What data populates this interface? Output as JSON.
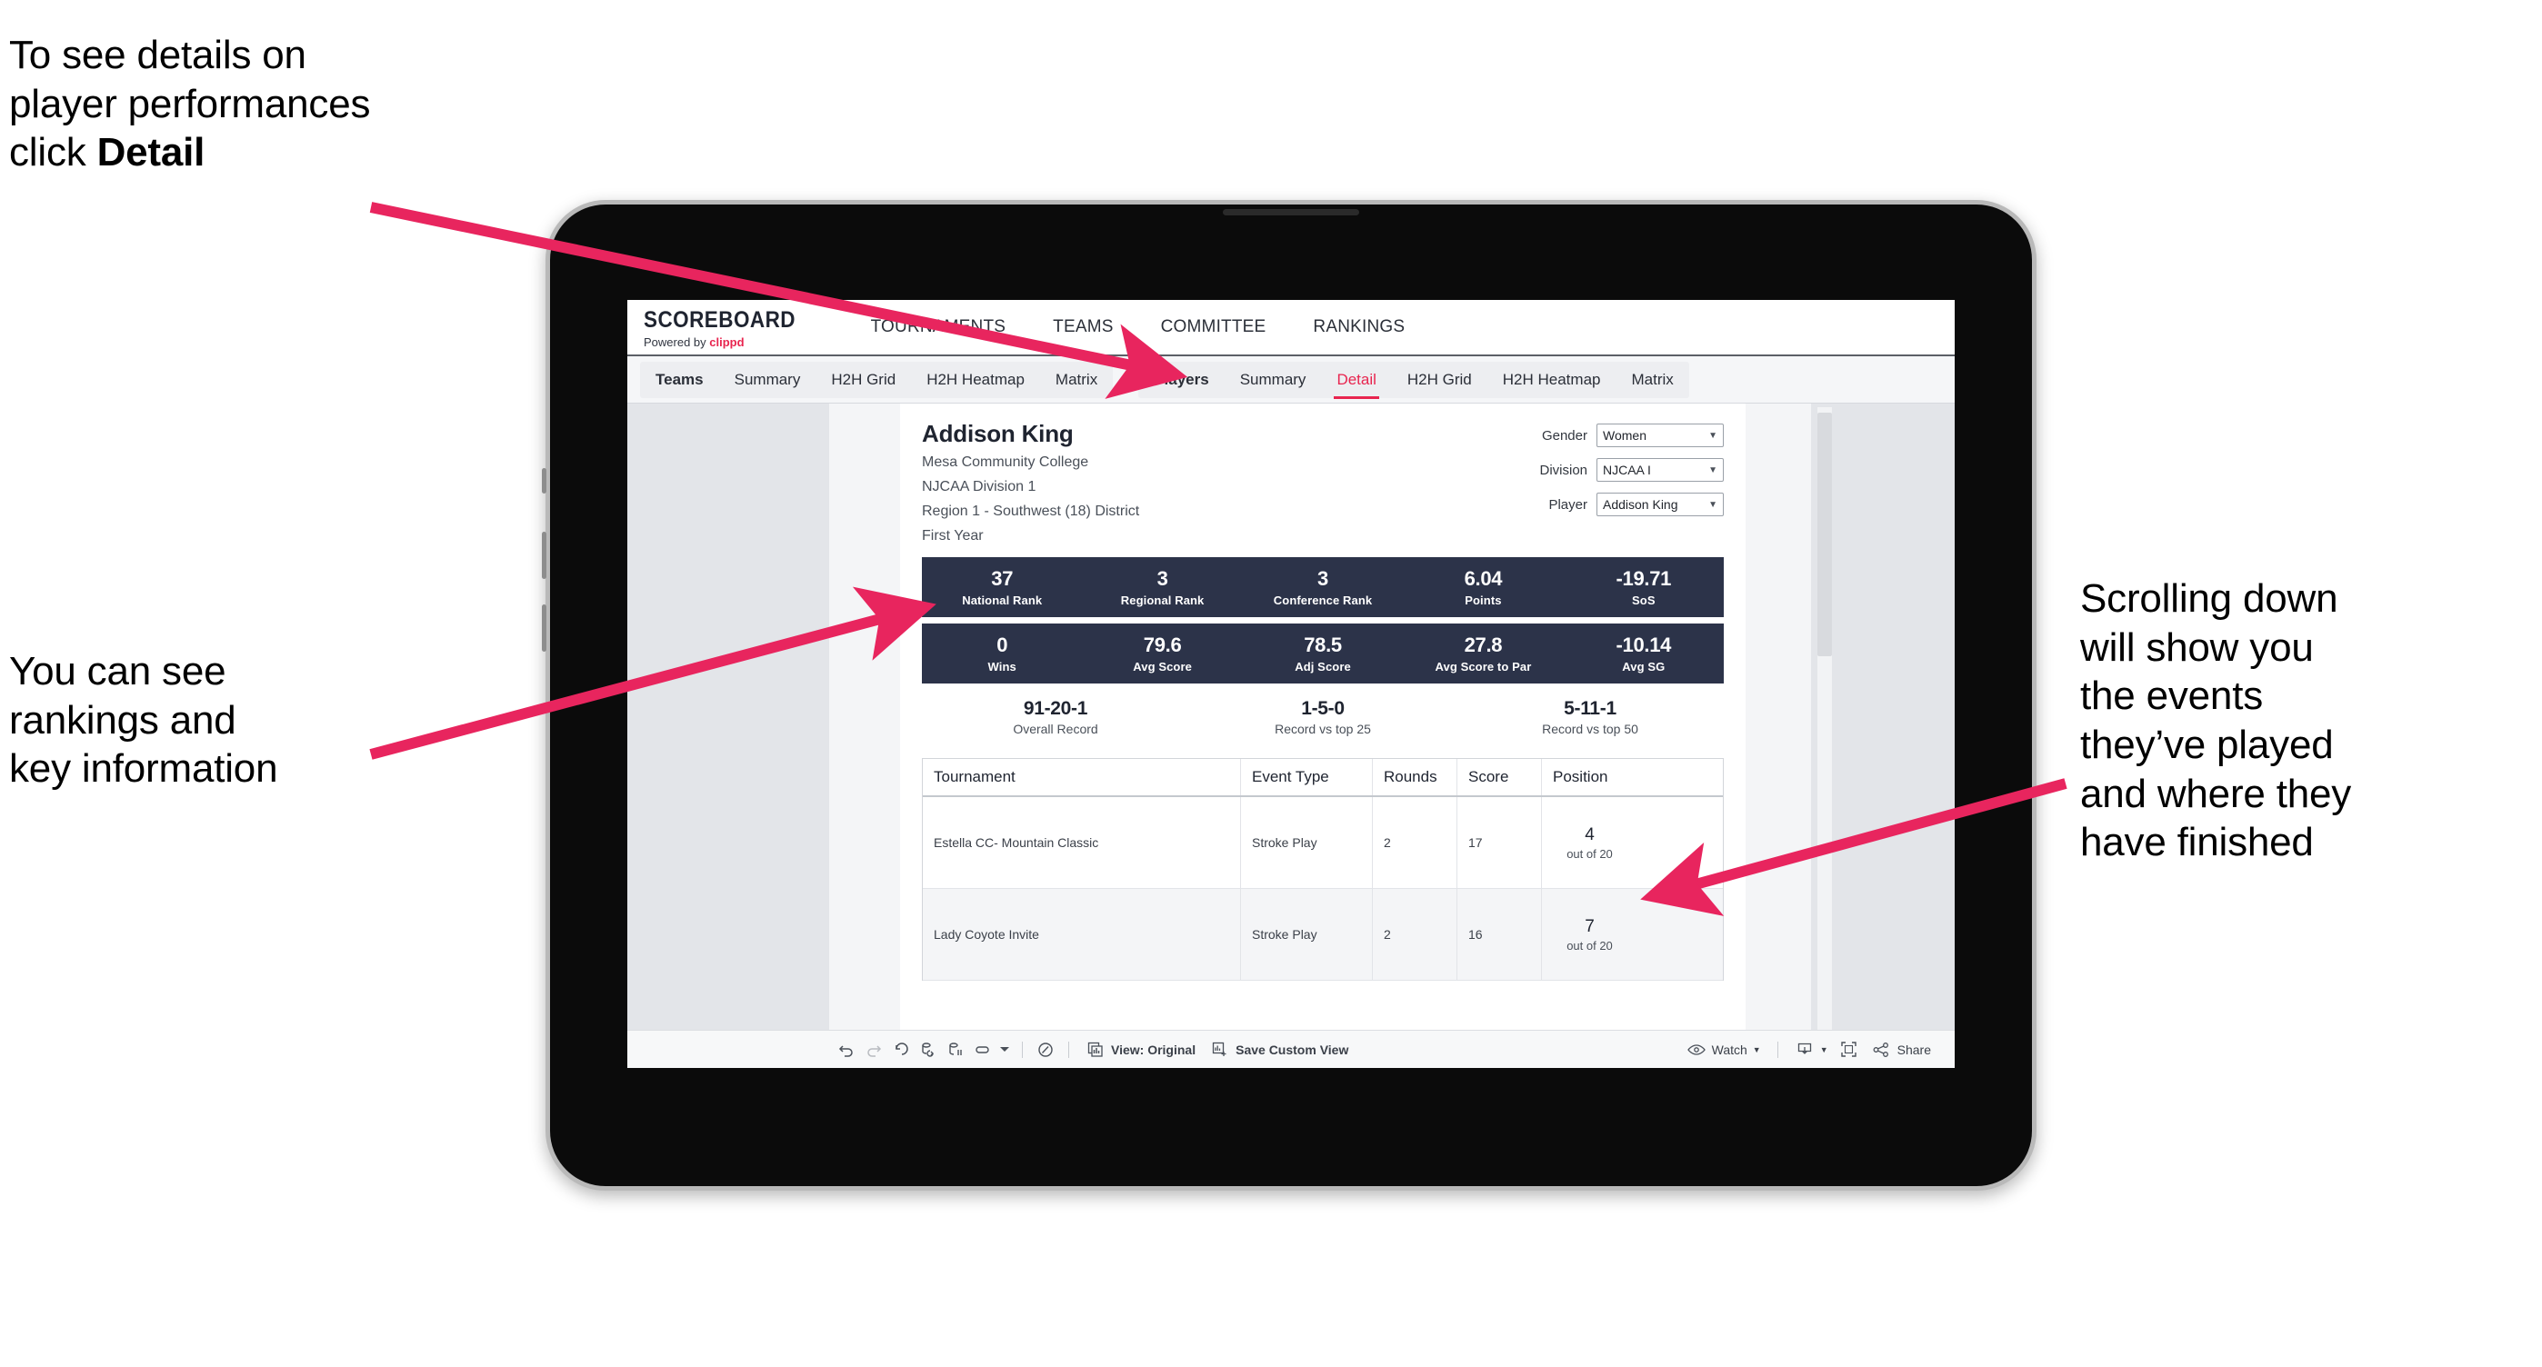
{
  "annotations": {
    "detail": "To see details on\nplayer performances\nclick ",
    "detail_bold": "Detail",
    "rankings": "You can see\nrankings and\nkey information",
    "scroll": "Scrolling down\nwill show you\nthe events\nthey’ve played\nand where they\nhave finished",
    "arrow_color": "#e8255e"
  },
  "app": {
    "brand_title": "SCOREBOARD",
    "brand_powered": "Powered by ",
    "brand_name": "clippd",
    "nav": [
      {
        "label": "TOURNAMENTS"
      },
      {
        "label": "TEAMS"
      },
      {
        "label": "COMMITTEE"
      },
      {
        "label": "RANKINGS"
      }
    ],
    "tab_group_teams": [
      {
        "label": "Teams",
        "lead": true
      },
      {
        "label": "Summary"
      },
      {
        "label": "H2H Grid"
      },
      {
        "label": "H2H Heatmap"
      },
      {
        "label": "Matrix"
      }
    ],
    "tab_group_players": [
      {
        "label": "Players",
        "lead": true
      },
      {
        "label": "Summary"
      },
      {
        "label": "Detail",
        "active": true
      },
      {
        "label": "H2H Grid"
      },
      {
        "label": "H2H Heatmap"
      },
      {
        "label": "Matrix"
      }
    ],
    "accent_color": "#e8254f"
  },
  "player": {
    "name": "Addison King",
    "school": "Mesa Community College",
    "division": "NJCAA Division 1",
    "region": "Region 1 - Southwest (18) District",
    "class_year": "First Year"
  },
  "filters": [
    {
      "label": "Gender",
      "value": "Women"
    },
    {
      "label": "Division",
      "value": "NJCAA I"
    },
    {
      "label": "Player",
      "value": "Addison King"
    }
  ],
  "stats_row_1": [
    {
      "value": "37",
      "label": "National Rank"
    },
    {
      "value": "3",
      "label": "Regional Rank"
    },
    {
      "value": "3",
      "label": "Conference Rank"
    },
    {
      "value": "6.04",
      "label": "Points"
    },
    {
      "value": "-19.71",
      "label": "SoS"
    }
  ],
  "stats_row_2": [
    {
      "value": "0",
      "label": "Wins"
    },
    {
      "value": "79.6",
      "label": "Avg Score"
    },
    {
      "value": "78.5",
      "label": "Adj Score"
    },
    {
      "value": "27.8",
      "label": "Avg Score to Par"
    },
    {
      "value": "-10.14",
      "label": "Avg SG"
    }
  ],
  "records": [
    {
      "value": "91-20-1",
      "label": "Overall Record"
    },
    {
      "value": "1-5-0",
      "label": "Record vs top 25"
    },
    {
      "value": "5-11-1",
      "label": "Record vs top 50"
    }
  ],
  "table": {
    "headers": [
      "Tournament",
      "Event Type",
      "Rounds",
      "Score",
      "Position"
    ],
    "rows": [
      {
        "tournament": "Estella CC- Mountain Classic",
        "event_type": "Stroke Play",
        "rounds": "2",
        "score": "17",
        "position": "4",
        "position_sub": "out of 20"
      },
      {
        "tournament": "Lady Coyote Invite",
        "event_type": "Stroke Play",
        "rounds": "2",
        "score": "16",
        "position": "7",
        "position_sub": "out of 20"
      }
    ]
  },
  "toolbar": {
    "view_label": "View: Original",
    "save_label": "Save Custom View",
    "watch_label": "Watch",
    "share_label": "Share"
  }
}
